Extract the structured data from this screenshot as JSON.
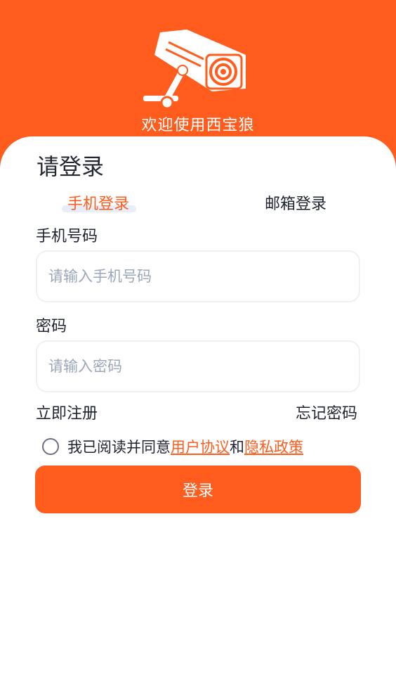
{
  "header": {
    "welcome_text": "欢迎使用西宝狼",
    "logo_icon": "security-camera-icon"
  },
  "form": {
    "title": "请登录",
    "tabs": [
      {
        "label": "手机登录",
        "active": true
      },
      {
        "label": "邮箱登录",
        "active": false
      }
    ],
    "phone": {
      "label": "手机号码",
      "placeholder": "请输入手机号码",
      "value": ""
    },
    "password": {
      "label": "密码",
      "placeholder": "请输入密码",
      "value": ""
    },
    "register_link": "立即注册",
    "forgot_link": "忘记密码",
    "agreement": {
      "prefix": "我已阅读并同意",
      "user_agreement": "用户协议",
      "and": "和",
      "privacy_policy": "隐私政策",
      "checked": false
    },
    "login_button": "登录"
  },
  "colors": {
    "accent": "#ff5c1e",
    "tab_underline": "#e7eef8",
    "placeholder": "#9aa7b8"
  }
}
